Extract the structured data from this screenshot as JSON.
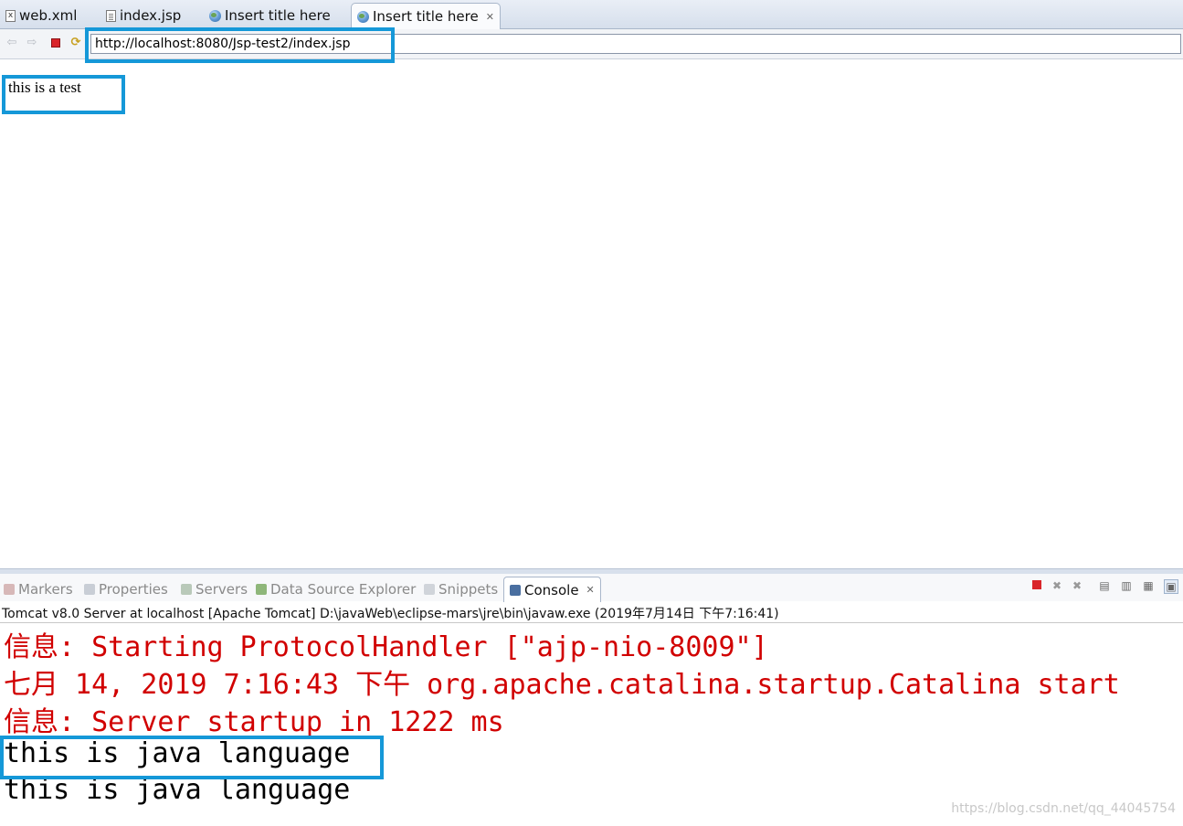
{
  "editor_tabs": [
    {
      "label": "web.xml",
      "icon": "xml-file-icon"
    },
    {
      "label": "index.jsp",
      "icon": "jsp-file-icon"
    },
    {
      "label": "Insert title here",
      "icon": "globe-icon"
    },
    {
      "label": "Insert title here",
      "icon": "globe-icon",
      "active": true
    }
  ],
  "browser": {
    "url": "http://localhost:8080/Jsp-test2/index.jsp"
  },
  "page": {
    "body_text": "this is a test"
  },
  "panel_tabs": [
    {
      "label": "Markers"
    },
    {
      "label": "Properties"
    },
    {
      "label": "Servers"
    },
    {
      "label": "Data Source Explorer"
    },
    {
      "label": "Snippets"
    },
    {
      "label": "Console",
      "active": true
    }
  ],
  "console": {
    "header": "Tomcat v8.0 Server at localhost [Apache Tomcat] D:\\javaWeb\\eclipse-mars\\jre\\bin\\javaw.exe (2019年7月14日 下午7:16:41)",
    "lines": [
      {
        "text": "信息: Starting ProtocolHandler [\"ajp-nio-8009\"]",
        "color": "#d10000"
      },
      {
        "text": "七月 14, 2019 7:16:43 下午 org.apache.catalina.startup.Catalina start",
        "color": "#d10000"
      },
      {
        "text": "信息: Server startup in 1222 ms",
        "color": "#d10000"
      },
      {
        "text": "this is java language",
        "color": "#000000"
      },
      {
        "text": "this is java language",
        "color": "#000000"
      }
    ]
  },
  "watermark": "https://blog.csdn.net/qq_44045754",
  "colors": {
    "highlight": "#1598d8",
    "console_error": "#d10000"
  }
}
